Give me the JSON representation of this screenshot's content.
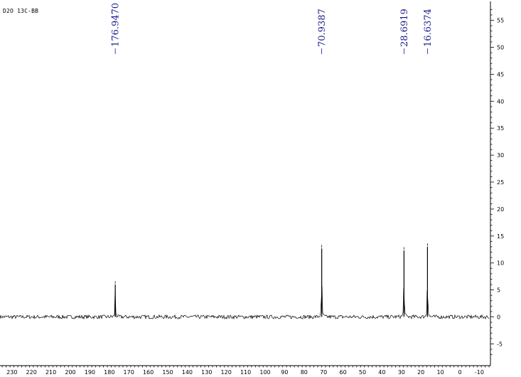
{
  "sample_label": "D2O  13C-BB",
  "chart_data": {
    "type": "line",
    "title": "",
    "xlabel": "",
    "ylabel": "",
    "xlim": [
      235,
      -15
    ],
    "ylim": [
      -7.5,
      58
    ],
    "x_reversed": true,
    "y_axis_side": "right",
    "grid": false,
    "x_ticks": [
      230,
      220,
      210,
      200,
      190,
      180,
      170,
      160,
      150,
      140,
      130,
      120,
      110,
      100,
      90,
      80,
      70,
      60,
      50,
      40,
      30,
      20,
      10,
      0,
      -10
    ],
    "x_tick_labels": [
      "230",
      "220",
      "210",
      "200",
      "190",
      "180",
      "170",
      "160",
      "150",
      "140",
      "130",
      "120",
      "110",
      "100",
      "90",
      "80",
      "70",
      "60",
      "50",
      "40",
      "30",
      "20",
      "10",
      "0",
      "-10"
    ],
    "y_ticks": [
      -5,
      0,
      5,
      10,
      15,
      20,
      25,
      30,
      35,
      40,
      45,
      50,
      55
    ],
    "y_tick_labels": [
      "-5",
      "0",
      "5",
      "10",
      "15",
      "20",
      "25",
      "30",
      "35",
      "40",
      "45",
      "50",
      "55"
    ],
    "peaks": [
      {
        "x": 176.947,
        "y": 6.0,
        "label": "176.9470"
      },
      {
        "x": 70.9387,
        "y": 12.7,
        "label": "70.9387"
      },
      {
        "x": 28.6919,
        "y": 12.3,
        "label": "28.6919"
      },
      {
        "x": 16.6374,
        "y": 13.0,
        "label": "16.6374"
      }
    ],
    "baseline": 0,
    "noise_amplitude": 0.35,
    "colors": {
      "spectrum": "#000000",
      "peak_label": "#1a1a8c",
      "axis": "#000000"
    }
  }
}
